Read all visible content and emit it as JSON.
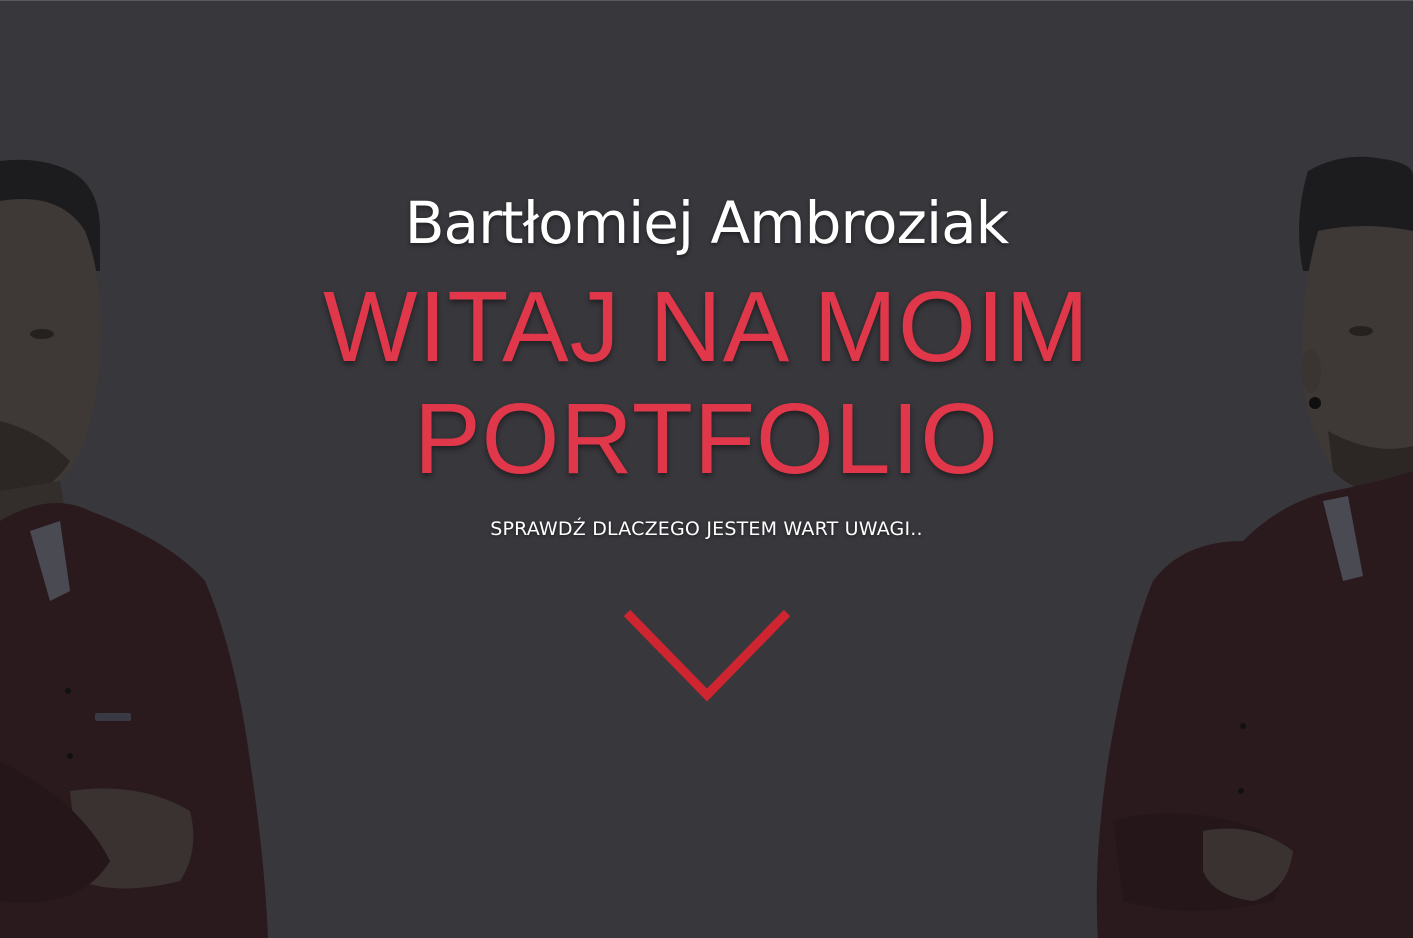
{
  "hero": {
    "name": "Bartłomiej Ambroziak",
    "headline": "WITAJ NA MOIM PORTFOLIO",
    "tagline": "SPRAWDŹ DLACZEGO JESTEM WART UWAGI.."
  },
  "scroll_down": {
    "icon": "chevron-down-icon",
    "color": "#cf2530"
  },
  "colors": {
    "background": "#38373c",
    "accent": "#e0384a",
    "text": "#ffffff"
  }
}
